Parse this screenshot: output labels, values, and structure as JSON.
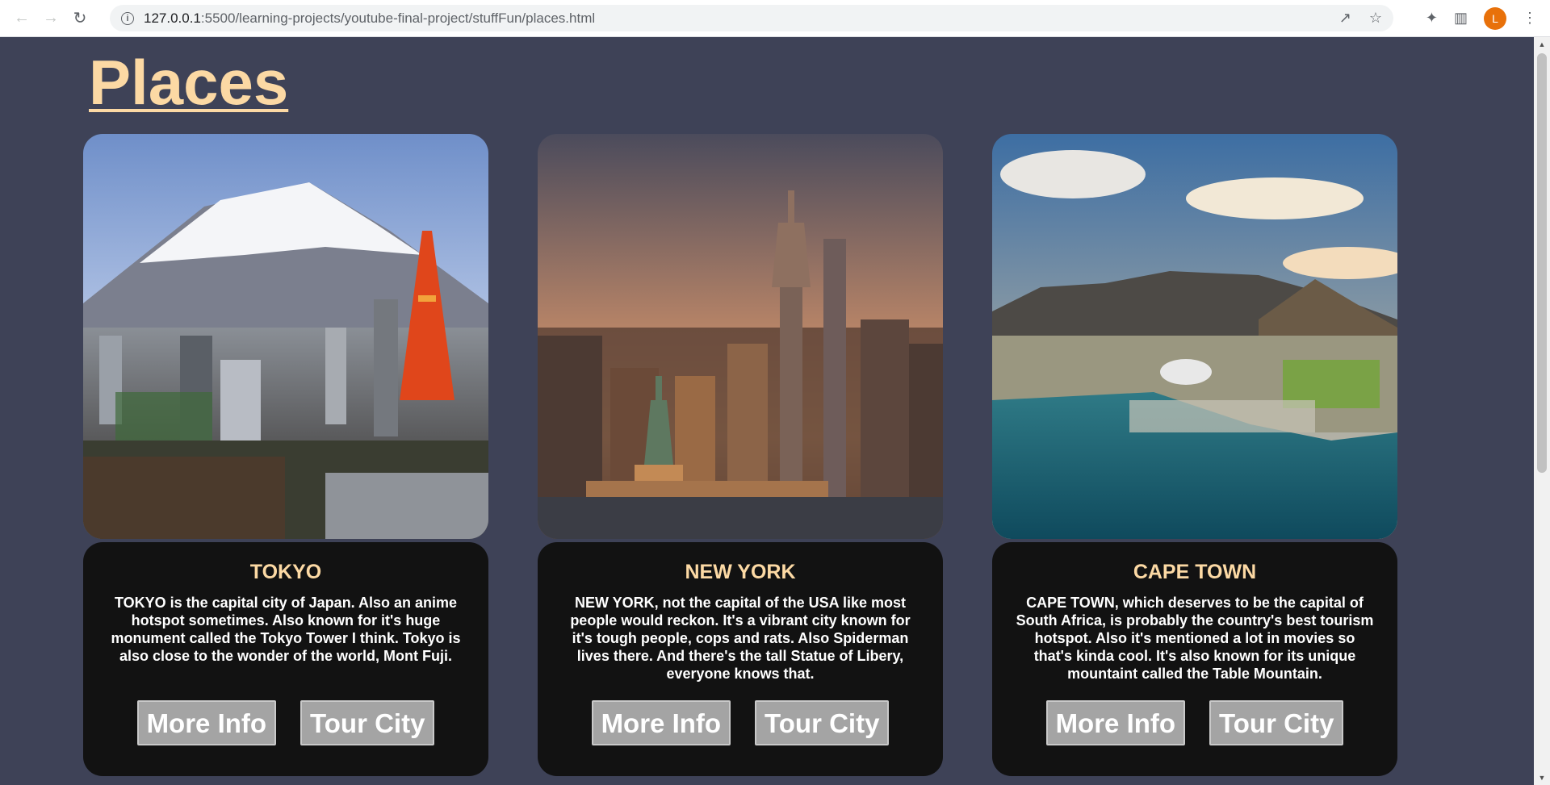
{
  "browser": {
    "url_host": "127.0.0.1",
    "url_rest": ":5500/learning-projects/youtube-final-project/stuffFun/places.html",
    "profile_initial": "L",
    "icons": [
      "back-icon",
      "forward-icon",
      "reload-icon",
      "info-icon",
      "share-icon",
      "star-icon",
      "extensions-icon",
      "sidepanel-icon",
      "menu-icon"
    ]
  },
  "page": {
    "title": "Places"
  },
  "cards": [
    {
      "title": "TOKYO",
      "description": "TOKYO is the capital city of Japan. Also an anime hotspot sometimes. Also known for it's huge monument called the Tokyo Tower I think. Tokyo is also close to the wonder of the world, Mont Fuji.",
      "more_info": "More Info",
      "tour": "Tour City"
    },
    {
      "title": "NEW YORK",
      "description": "NEW YORK, not the capital of the USA like most people would reckon. It's a vibrant city known for it's tough people, cops and rats. Also Spiderman lives there. And there's the tall Statue of Libery, everyone knows that.",
      "more_info": "More Info",
      "tour": "Tour City"
    },
    {
      "title": "CAPE TOWN",
      "description": "CAPE TOWN, which deserves to be the capital of South Africa, is probably the country's best tourism hotspot. Also it's mentioned a lot in movies so that's kinda cool. It's also known for its unique mountaint called the Table Mountain.",
      "more_info": "More Info",
      "tour": "Tour City"
    }
  ],
  "colors": {
    "background": "#3e4257",
    "card": "#121212",
    "heading": "#fcd9a4",
    "button": "#a4a4a4"
  }
}
